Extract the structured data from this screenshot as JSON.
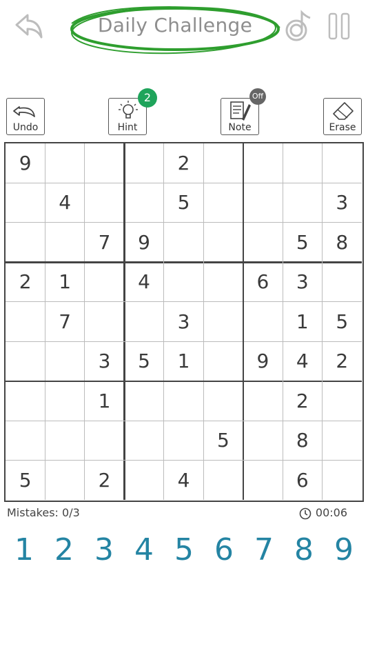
{
  "header": {
    "title": "Daily Challenge",
    "icons": {
      "back": "undo-arrow-icon",
      "music": "music-note-icon",
      "pause": "pause-icon"
    },
    "title_ring_color": "#2e9e2e"
  },
  "toolbar": {
    "undo_label": "Undo",
    "hint_label": "Hint",
    "hint_count": "2",
    "note_label": "Note",
    "note_state": "Off",
    "erase_label": "Erase"
  },
  "board": {
    "grid": [
      [
        "9",
        "",
        "",
        "",
        "2",
        "",
        "",
        "",
        ""
      ],
      [
        "",
        "4",
        "",
        "",
        "5",
        "",
        "",
        "",
        "3"
      ],
      [
        "",
        "",
        "7",
        "9",
        "",
        "",
        "",
        "5",
        "8"
      ],
      [
        "2",
        "1",
        "",
        "4",
        "",
        "",
        "6",
        "3",
        ""
      ],
      [
        "",
        "7",
        "",
        "",
        "3",
        "",
        "",
        "1",
        "5"
      ],
      [
        "",
        "",
        "3",
        "5",
        "1",
        "",
        "9",
        "4",
        "2"
      ],
      [
        "",
        "",
        "1",
        "",
        "",
        "",
        "",
        "2",
        ""
      ],
      [
        "",
        "",
        "",
        "",
        "",
        "5",
        "",
        "8",
        ""
      ],
      [
        "5",
        "",
        "2",
        "",
        "4",
        "",
        "",
        "6",
        ""
      ]
    ]
  },
  "status": {
    "mistakes_label": "Mistakes:",
    "mistakes_value": "0/3",
    "timer": "00:06"
  },
  "numpad": {
    "digits": [
      "1",
      "2",
      "3",
      "4",
      "5",
      "6",
      "7",
      "8",
      "9"
    ],
    "digit_color": "#2484a3"
  }
}
